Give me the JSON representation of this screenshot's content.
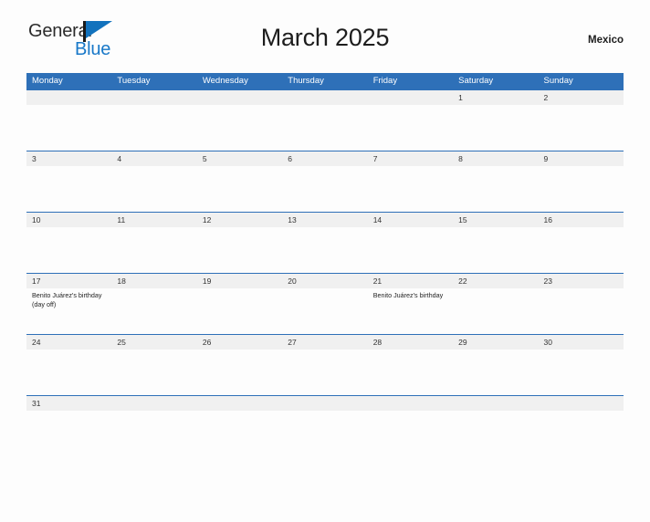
{
  "brand": {
    "name_part1": "General",
    "name_part2": "Blue",
    "flag_icon": "general-blue-flag-icon",
    "color_dark": "#2b2b2b",
    "color_blue": "#1878c8"
  },
  "header": {
    "title": "March 2025",
    "country": "Mexico"
  },
  "calendar": {
    "header_color": "#2e70b8",
    "date_strip_color": "#f0f0f0",
    "weekdays": [
      "Monday",
      "Tuesday",
      "Wednesday",
      "Thursday",
      "Friday",
      "Saturday",
      "Sunday"
    ],
    "weeks": [
      [
        {
          "day": ""
        },
        {
          "day": ""
        },
        {
          "day": ""
        },
        {
          "day": ""
        },
        {
          "day": ""
        },
        {
          "day": "1"
        },
        {
          "day": "2"
        }
      ],
      [
        {
          "day": "3"
        },
        {
          "day": "4"
        },
        {
          "day": "5"
        },
        {
          "day": "6"
        },
        {
          "day": "7"
        },
        {
          "day": "8"
        },
        {
          "day": "9"
        }
      ],
      [
        {
          "day": "10"
        },
        {
          "day": "11"
        },
        {
          "day": "12"
        },
        {
          "day": "13"
        },
        {
          "day": "14"
        },
        {
          "day": "15"
        },
        {
          "day": "16"
        }
      ],
      [
        {
          "day": "17",
          "event": "Benito Juárez's birthday (day off)"
        },
        {
          "day": "18"
        },
        {
          "day": "19"
        },
        {
          "day": "20"
        },
        {
          "day": "21",
          "event": "Benito Juárez's birthday"
        },
        {
          "day": "22"
        },
        {
          "day": "23"
        }
      ],
      [
        {
          "day": "24"
        },
        {
          "day": "25"
        },
        {
          "day": "26"
        },
        {
          "day": "27"
        },
        {
          "day": "28"
        },
        {
          "day": "29"
        },
        {
          "day": "30"
        }
      ],
      [
        {
          "day": "31"
        },
        {
          "day": ""
        },
        {
          "day": ""
        },
        {
          "day": ""
        },
        {
          "day": ""
        },
        {
          "day": ""
        },
        {
          "day": ""
        }
      ]
    ]
  }
}
